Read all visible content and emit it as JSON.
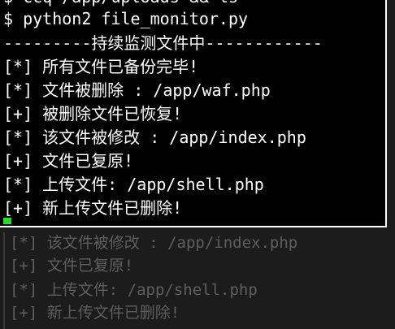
{
  "terminal": {
    "partial_top": "$ ccq /app/uploads && ls",
    "prompt": "$",
    "command": "python2 file_monitor.py",
    "banner": "---------持续监测文件中------------",
    "lines": [
      "[*] 所有文件已备份完毕!",
      "[*] 文件被删除 : /app/waf.php",
      "[+] 被删除文件已恢复!",
      "[*] 该文件被修改 : /app/index.php",
      "[+] 文件已复原!",
      "[*] 上传文件: /app/shell.php",
      "[+] 新上传文件已删除!"
    ],
    "cursor_color": "#2bd82b"
  },
  "echo": {
    "lines": [
      "[*] 该文件被修改 : /app/index.php",
      "[+] 文件已复原!",
      "[*] 上传文件: /app/shell.php",
      "[+] 新上传文件已删除!"
    ]
  }
}
